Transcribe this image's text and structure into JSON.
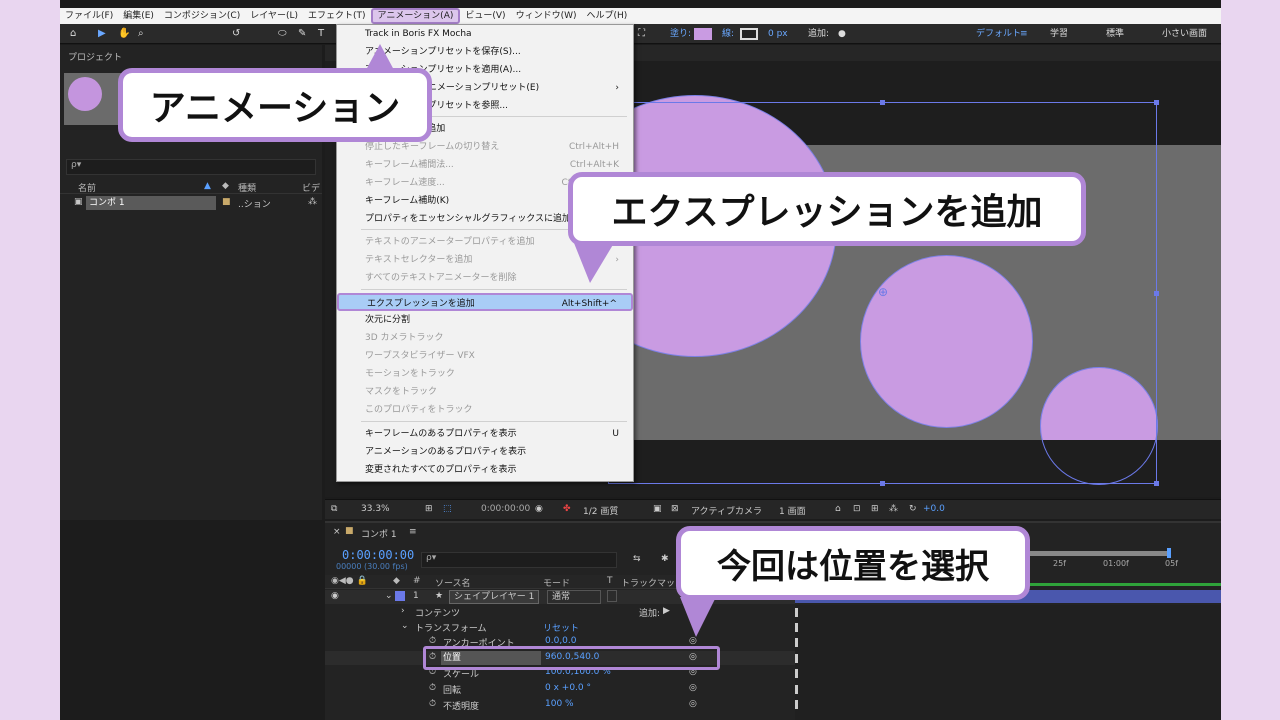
{
  "menubar": {
    "items": [
      "ファイル(F)",
      "編集(E)",
      "コンポジション(C)",
      "レイヤー(L)",
      "エフェクト(T)",
      "アニメーション(A)",
      "ビュー(V)",
      "ウィンドウ(W)",
      "ヘルプ(H)"
    ]
  },
  "toolbar": {
    "fill_label": "塗り:",
    "stroke_label": "線:",
    "stroke_width": "0 px",
    "add_label": "追加:",
    "workspaces": [
      "デフォルト",
      "学習",
      "標準",
      "小さい画面"
    ]
  },
  "project_panel": {
    "title": "プロジェクト",
    "search_placeholder": "ρ▾",
    "col_name": "名前",
    "col_type": "種類",
    "col_video": "ビデ",
    "comp_name": "コンポ 1",
    "comp_type": "..ション"
  },
  "dropdown": {
    "items": [
      {
        "label": "Track in Boris FX Mocha",
        "shortcut": "",
        "disabled": false
      },
      {
        "label": "アニメーションプリセットを保存(S)...",
        "shortcut": "",
        "disabled": false
      },
      {
        "label": "アニメーションプリセットを適用(A)...",
        "shortcut": "",
        "disabled": false
      },
      {
        "label": "最近使用したアニメーションプリセット(E)",
        "shortcut": "›",
        "disabled": false
      },
      {
        "label": "アニメーションプリセットを参照...",
        "shortcut": "",
        "disabled": false
      },
      {
        "label": "キーフレームを追加",
        "shortcut": "",
        "disabled": false
      },
      {
        "label": "停止したキーフレームの切り替え",
        "shortcut": "Ctrl+Alt+H",
        "disabled": true
      },
      {
        "label": "キーフレーム補間法...",
        "shortcut": "Ctrl+Alt+K",
        "disabled": true
      },
      {
        "label": "キーフレーム速度...",
        "shortcut": "Ctrl+Shift+K",
        "disabled": true
      },
      {
        "label": "キーフレーム補助(K)",
        "shortcut": "",
        "disabled": false
      },
      {
        "label": "プロパティをエッセンシャルグラフィックスに追加",
        "shortcut": "",
        "disabled": false
      },
      {
        "label": "テキストのアニメータープロパティを追加",
        "shortcut": "",
        "disabled": true
      },
      {
        "label": "テキストセレクターを追加",
        "shortcut": "›",
        "disabled": true
      },
      {
        "label": "すべてのテキストアニメーターを削除",
        "shortcut": "",
        "disabled": true
      },
      {
        "label": "エクスプレッションを追加",
        "shortcut": "Alt+Shift+^",
        "disabled": false,
        "highlight": true
      },
      {
        "label": "次元に分割",
        "shortcut": "",
        "disabled": false
      },
      {
        "label": "3D カメラトラック",
        "shortcut": "",
        "disabled": true
      },
      {
        "label": "ワープスタビライザー VFX",
        "shortcut": "",
        "disabled": true
      },
      {
        "label": "モーションをトラック",
        "shortcut": "",
        "disabled": true
      },
      {
        "label": "マスクをトラック",
        "shortcut": "",
        "disabled": true
      },
      {
        "label": "このプロパティをトラック",
        "shortcut": "",
        "disabled": true
      },
      {
        "label": "キーフレームのあるプロパティを表示",
        "shortcut": "U",
        "disabled": false
      },
      {
        "label": "アニメーションのあるプロパティを表示",
        "shortcut": "",
        "disabled": false
      },
      {
        "label": "変更されたすべてのプロパティを表示",
        "shortcut": "",
        "disabled": false
      }
    ]
  },
  "viewer_bar": {
    "zoom": "33.3%",
    "timecode": "0:00:00:00",
    "resolution": "1/2 画質",
    "camera": "アクティブカメラ",
    "views": "1 画面",
    "exposure": "+0.0"
  },
  "timeline": {
    "tab": "コンポ 1",
    "current_time": "0:00:00:00",
    "fps": "00000 (30.00 fps)",
    "search_placeholder": "ρ▾",
    "col_source": "ソース名",
    "col_mode": "モード",
    "col_t": "T",
    "col_trackmatte": "トラックマット",
    "layer_num": "1",
    "layer_name": "シェイプレイヤー 1",
    "layer_mode": "通常",
    "contents": "コンテンツ",
    "add_label": "追加:",
    "transform": "トランスフォーム",
    "reset": "リセット",
    "props": [
      {
        "name": "アンカーポイント",
        "value": "0.0,0.0"
      },
      {
        "name": "位置",
        "value": "960.0,540.0"
      },
      {
        "name": "スケール",
        "value": "100.0,100.0 %"
      },
      {
        "name": "回転",
        "value": "0 x +0.0 °"
      },
      {
        "name": "不透明度",
        "value": "100 %"
      }
    ],
    "ruler_labels": [
      "25f",
      "01:00f",
      "05f"
    ]
  },
  "callouts": {
    "menu": "アニメーション",
    "expression": "エクスプレッションを追加",
    "position": "今回は位置を選択"
  },
  "colors": {
    "accent": "#b087d6",
    "shape_fill": "#c99be2",
    "selection_blue": "#6b79e8",
    "timecode_blue": "#5aa0ff"
  }
}
